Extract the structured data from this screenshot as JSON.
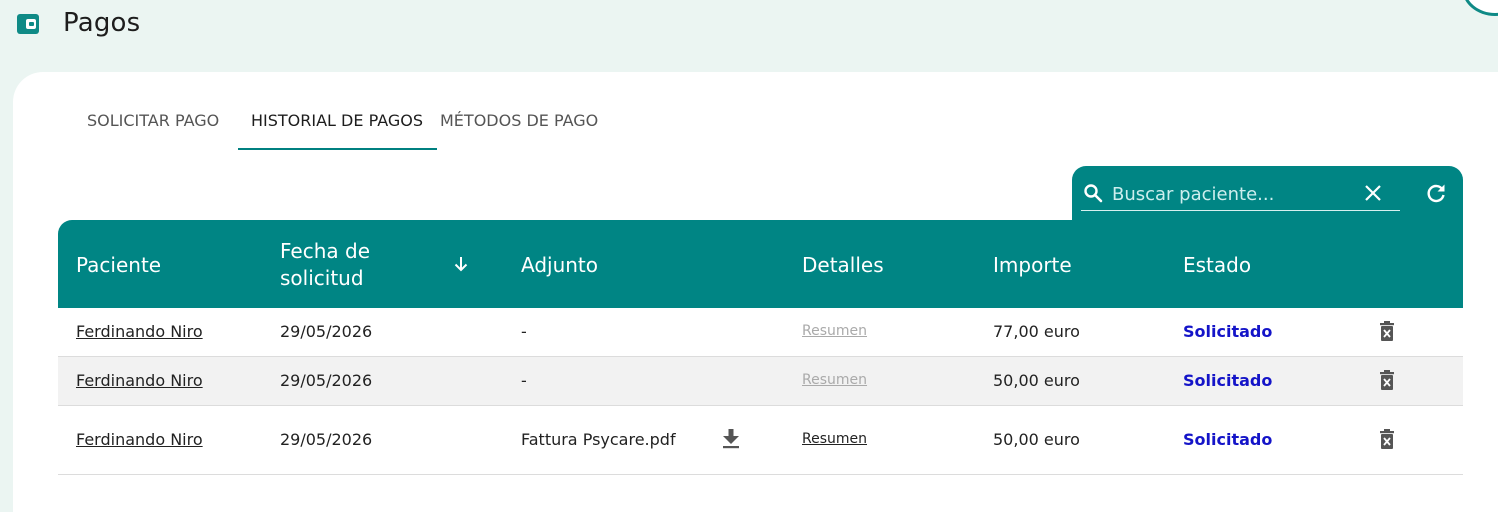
{
  "header": {
    "title": "Pagos",
    "icon": "wallet-icon"
  },
  "tabs": [
    {
      "label": "SOLICITAR PAGO",
      "active": false
    },
    {
      "label": "HISTORIAL DE PAGOS",
      "active": true
    },
    {
      "label": "MÉTODOS DE PAGO",
      "active": false
    }
  ],
  "search": {
    "placeholder": "Buscar paciente...",
    "value": ""
  },
  "table": {
    "columns": {
      "patient": "Paciente",
      "date_line1": "Fecha de",
      "date_line2": "solicitud",
      "attachment": "Adjunto",
      "details": "Detalles",
      "amount": "Importe",
      "status": "Estado"
    },
    "sort": {
      "column": "Fecha de solicitud",
      "direction": "descending"
    },
    "rows": [
      {
        "patient": "Ferdinando Niro",
        "date": "29/05/2026",
        "attachment": "-",
        "details": "Resumen",
        "details_enabled": false,
        "amount": "77,00 euro",
        "status": "Solicitado"
      },
      {
        "patient": "Ferdinando Niro",
        "date": "29/05/2026",
        "attachment": "-",
        "details": "Resumen",
        "details_enabled": false,
        "amount": "50,00 euro",
        "status": "Solicitado"
      },
      {
        "patient": "Ferdinando Niro",
        "date": "29/05/2026",
        "attachment": "Fattura Psycare.pdf",
        "details": "Resumen",
        "details_enabled": true,
        "amount": "50,00 euro",
        "status": "Solicitado"
      }
    ]
  },
  "colors": {
    "primary": "#008584",
    "status": "#1414c8",
    "background": "#ebf5f2"
  }
}
